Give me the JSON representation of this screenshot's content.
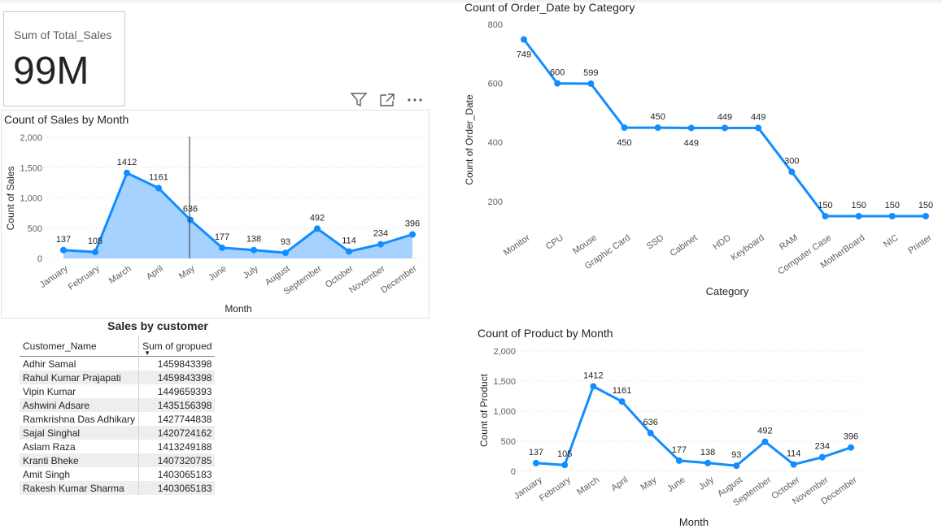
{
  "card": {
    "label": "Sum of Total_Sales",
    "value": "99M"
  },
  "toolbar": {
    "icons": [
      "filter-icon",
      "focus-mode-icon",
      "more-options-icon"
    ]
  },
  "table": {
    "title": "Sales by customer",
    "columns": [
      "Customer_Name",
      "Sum of gropued"
    ],
    "rows": [
      [
        "Adhir Samal",
        "1459843398"
      ],
      [
        "Rahul Kumar Prajapati",
        "1459843398"
      ],
      [
        "Vipin Kumar",
        "1449659393"
      ],
      [
        "Ashwini Adsare",
        "1435156398"
      ],
      [
        "Ramkrishna Das Adhikary",
        "1427744838"
      ],
      [
        "Sajal Singhal",
        "1420724162"
      ],
      [
        "Aslam Raza",
        "1413249188"
      ],
      [
        "Kranti Bheke",
        "1407320785"
      ],
      [
        "Amit Singh",
        "1403065183"
      ],
      [
        "Rakesh Kumar Sharma",
        "1403065183"
      ]
    ]
  },
  "chart_data": [
    {
      "type": "area",
      "title": "Count of Sales by Month",
      "xlabel": "Month",
      "ylabel": "Count of Sales",
      "categories": [
        "January",
        "February",
        "March",
        "April",
        "May",
        "June",
        "July",
        "August",
        "September",
        "October",
        "November",
        "December"
      ],
      "values": [
        137,
        105,
        1412,
        1161,
        636,
        177,
        138,
        93,
        492,
        114,
        234,
        396
      ],
      "data_labels": [
        "137",
        "105",
        "1412",
        "1161",
        "636",
        "177",
        "138",
        "93",
        "492",
        "114",
        "234",
        "396"
      ],
      "ylim": [
        0,
        2000
      ],
      "yticks": [
        0,
        500,
        1000,
        1500,
        2000
      ],
      "ytick_labels": [
        "0",
        "500",
        "1,000",
        "1,500",
        "2,000"
      ],
      "grid": true,
      "color": "#118dff",
      "fill": "#a7d2ff"
    },
    {
      "type": "line",
      "title": "Count of Order_Date by Category",
      "xlabel": "Category",
      "ylabel": "Count of Order_Date",
      "categories": [
        "Monitor",
        "CPU",
        "Mouse",
        "Graphic Card",
        "SSD",
        "Cabinet",
        "HDD",
        "Keyboard",
        "RAM",
        "Computer Case",
        "MotherBoard",
        "NIC",
        "Printer"
      ],
      "values": [
        749,
        600,
        599,
        450,
        450,
        449,
        449,
        449,
        300,
        150,
        150,
        150,
        150
      ],
      "data_labels": [
        "749",
        "600",
        "599",
        "450",
        "450",
        "449",
        "449",
        "449",
        "300",
        "150",
        "150",
        "150",
        "150"
      ],
      "ylim": [
        150,
        800
      ],
      "yticks": [
        200,
        400,
        600,
        800
      ],
      "ytick_labels": [
        "200",
        "400",
        "600",
        "800"
      ],
      "grid": false,
      "color": "#118dff"
    },
    {
      "type": "line",
      "title": "Count of Product by Month",
      "xlabel": "Month",
      "ylabel": "Count of Product",
      "categories": [
        "January",
        "February",
        "March",
        "April",
        "May",
        "June",
        "July",
        "August",
        "September",
        "October",
        "November",
        "December"
      ],
      "values": [
        137,
        105,
        1412,
        1161,
        636,
        177,
        138,
        93,
        492,
        114,
        234,
        396
      ],
      "data_labels": [
        "137",
        "105",
        "1412",
        "1161",
        "636",
        "177",
        "138",
        "93",
        "492",
        "114",
        "234",
        "396"
      ],
      "ylim": [
        0,
        2000
      ],
      "yticks": [
        0,
        500,
        1000,
        1500,
        2000
      ],
      "ytick_labels": [
        "0",
        "500",
        "1,000",
        "1,500",
        "2,000"
      ],
      "grid": true,
      "color": "#118dff"
    }
  ]
}
